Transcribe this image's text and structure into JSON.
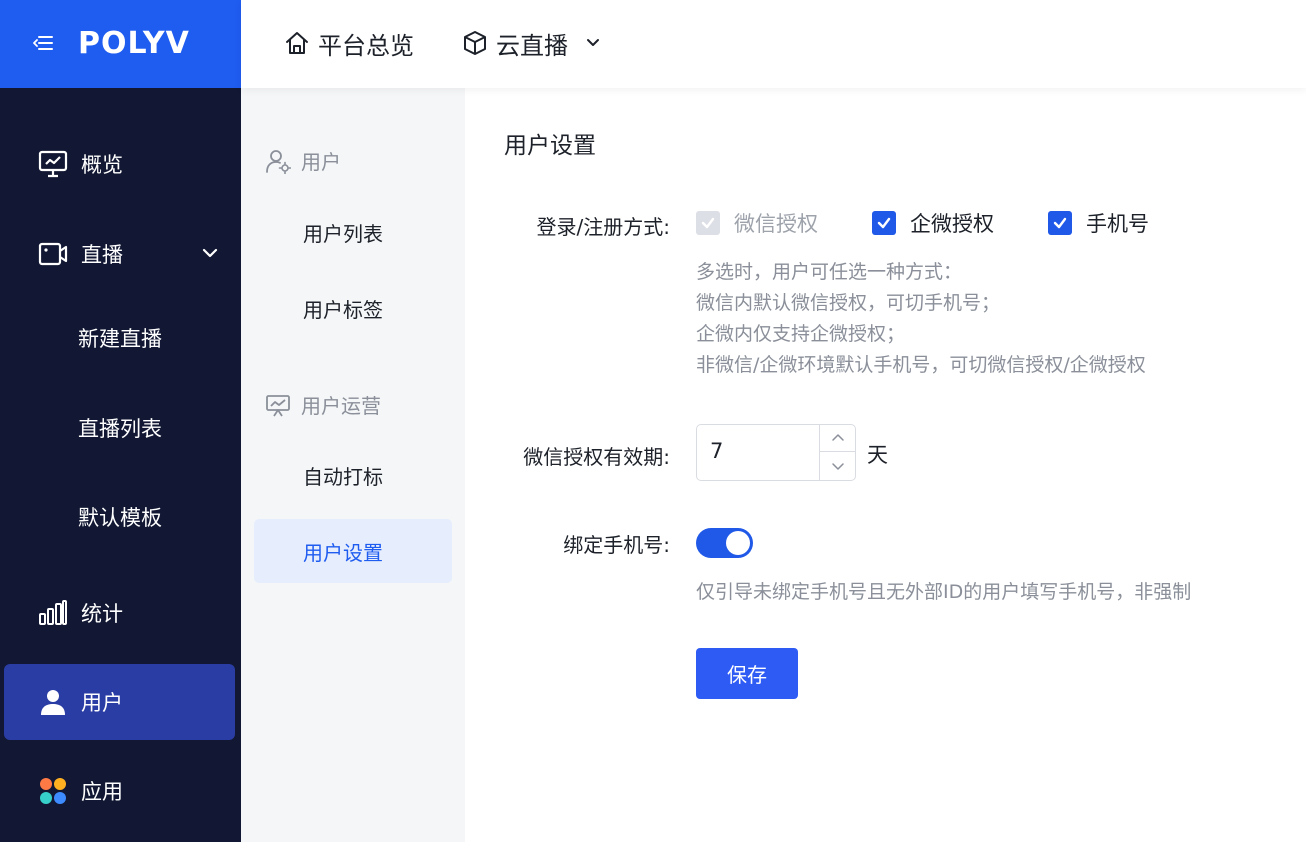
{
  "brand": {
    "logo": "POLYV"
  },
  "topbar": {
    "home_label": "平台总览",
    "product_label": "云直播"
  },
  "sidebar": {
    "items": [
      {
        "label": "概览"
      },
      {
        "label": "直播"
      },
      {
        "label": "新建直播"
      },
      {
        "label": "直播列表"
      },
      {
        "label": "默认模板"
      },
      {
        "label": "统计"
      },
      {
        "label": "用户"
      },
      {
        "label": "应用"
      }
    ]
  },
  "subnav": {
    "group_user": "用户",
    "user_list": "用户列表",
    "user_tags": "用户标签",
    "group_ops": "用户运营",
    "auto_tag": "自动打标",
    "user_settings": "用户设置"
  },
  "main": {
    "title": "用户设置",
    "login_label": "登录/注册方式:",
    "options": [
      "微信授权",
      "企微授权",
      "手机号"
    ],
    "login_help": [
      "多选时，用户可任选一种方式：",
      "微信内默认微信授权，可切手机号；",
      "企微内仅支持企微授权；",
      "非微信/企微环境默认手机号，可切微信授权/企微授权"
    ],
    "validity_label": "微信授权有效期:",
    "validity_value": "7",
    "validity_unit": "天",
    "bind_label": "绑定手机号:",
    "bind_help": "仅引导未绑定手机号且无外部ID的用户填写手机号，非强制",
    "save_label": "保存"
  },
  "colors": {
    "brand_blue": "#1f5cf0",
    "sidebar_bg": "#121833",
    "active_nav": "#2a3da4",
    "primary": "#2059e8"
  }
}
